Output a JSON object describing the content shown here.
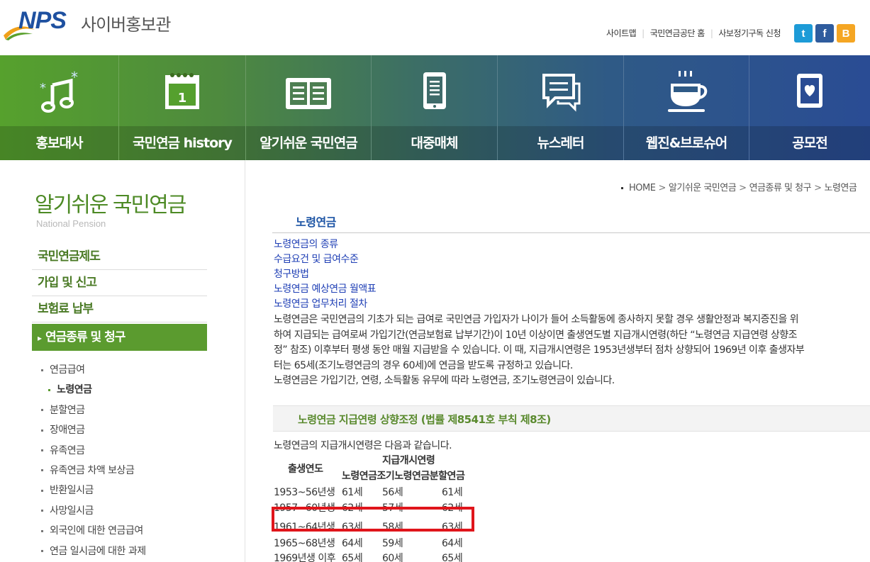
{
  "brand": {
    "logo_text": "NPS",
    "site_name": "사이버홍보관"
  },
  "util_links": [
    "사이트맵",
    "국민연금공단 홈",
    "사보정기구독 신청"
  ],
  "social": [
    {
      "name": "twitter",
      "glyph": "t",
      "color": "#1d9bd7"
    },
    {
      "name": "facebook",
      "glyph": "f",
      "color": "#2f5c9e"
    },
    {
      "name": "blog",
      "glyph": "B",
      "color": "#f5a623"
    }
  ],
  "gnb": [
    {
      "label": "홍보대사",
      "icon": "music-note-icon"
    },
    {
      "label": "국민연금 history",
      "icon": "calendar-icon"
    },
    {
      "label": "알기쉬운 국민연금",
      "icon": "open-book-icon"
    },
    {
      "label": "대중매체",
      "icon": "tablet-document-icon"
    },
    {
      "label": "뉴스레터",
      "icon": "chat-bubble-icon"
    },
    {
      "label": "웹진&브로슈어",
      "icon": "coffee-cup-icon"
    },
    {
      "label": "공모전",
      "icon": "heart-card-icon"
    }
  ],
  "lnb": {
    "title": "알기쉬운 국민연금",
    "subtitle": "National Pension",
    "main_items": [
      "국민연금제도",
      "가입 및 신고",
      "보험료 납부",
      "연금종류 및 청구"
    ],
    "sub_items": [
      "연금급여",
      "노령연금",
      "분할연금",
      "장애연금",
      "유족연금",
      "유족연금 차액 보상금",
      "반환일시금",
      "사망일시금",
      "외국인에 대한 연금급여",
      "연금 일시금에 대한 과제"
    ]
  },
  "breadcrumb": [
    "HOME",
    "알기쉬운 국민연금",
    "연금종류 및 청구",
    "노령연금"
  ],
  "content": {
    "heading": "노령연금",
    "doc_links": [
      "노령연금의 종류",
      "수급요건 및 급여수준",
      "청구방법",
      "노령연금 예상연금 월액표",
      "노령연금 업무처리 절차"
    ],
    "intro_lines": [
      "노령연금은 국민연금의 기초가 되는 급여로 국민연금 가입자가 나이가 들어 소득활동에 종사하지 못할 경우 생활안정과 복지증진을 위",
      "하여 지급되는 급여로써 가입기간(연금보험료 납부기간)이 10년 이상이면 출생연도별 지급개시연령(하단 “노령연금 지급연령 상향조",
      "정” 참조) 이후부터 평생 동안 매월 지급받을 수 있습니다. 이 때, 지급개시연령은 1953년생부터 점차 상향되어 1969년 이후 출생자부",
      "터는 65세(조기노령연금의 경우 60세)에 연금을 받도록 규정하고 있습니다.",
      "노령연금은 가입기간, 연령, 소득활동 유무에 따라 노령연금, 조기노령연금이 있습니다."
    ],
    "section_title": "노령연금 지급연령 상향조정 (법률 제8541호 부칙 제8조)",
    "age_intro": "노령연금의 지급개시연령은 다음과 같습니다.",
    "age_table": {
      "head_year": "출생연도",
      "head_group": "지급개시연령",
      "head_cols": "노령연금조기노령연금분할연금",
      "rows": [
        [
          "1953~56년생",
          "61세",
          "56세",
          "61세"
        ],
        [
          "1957~60년생",
          "62세",
          "57세",
          "62세"
        ],
        [
          "1961~64년생",
          "63세",
          "58세",
          "63세"
        ],
        [
          "1965~68년생",
          "64세",
          "59세",
          "64세"
        ],
        [
          "1969년생 이후",
          "65세",
          "60세",
          "65세"
        ]
      ],
      "highlighted_row": 2
    }
  }
}
